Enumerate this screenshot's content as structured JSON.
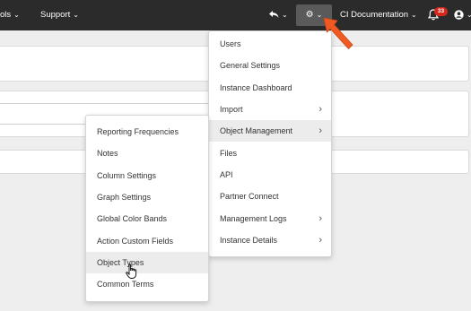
{
  "topbar": {
    "tools_label": "ols",
    "support_label": "Support",
    "ci_documentation_label": "CI Documentation",
    "notification_count": "33"
  },
  "settings_menu": {
    "items": [
      {
        "label": "Users",
        "has_submenu": false
      },
      {
        "label": "General Settings",
        "has_submenu": false
      },
      {
        "label": "Instance Dashboard",
        "has_submenu": false
      },
      {
        "label": "Import",
        "has_submenu": true
      },
      {
        "label": "Object Management",
        "has_submenu": true,
        "highlighted": true
      },
      {
        "label": "Files",
        "has_submenu": false
      },
      {
        "label": "API",
        "has_submenu": false
      },
      {
        "label": "Partner Connect",
        "has_submenu": false
      },
      {
        "label": "Management Logs",
        "has_submenu": true
      },
      {
        "label": "Instance Details",
        "has_submenu": true
      }
    ]
  },
  "object_management_submenu": {
    "items": [
      {
        "label": "Reporting Frequencies"
      },
      {
        "label": "Notes"
      },
      {
        "label": "Column Settings"
      },
      {
        "label": "Graph Settings"
      },
      {
        "label": "Global Color Bands"
      },
      {
        "label": "Action Custom Fields"
      },
      {
        "label": "Object Types",
        "highlighted": true
      },
      {
        "label": "Common Terms"
      }
    ]
  },
  "colors": {
    "topbar_bg": "#2b2b2b",
    "badge_bg": "#d9261c",
    "callout_arrow": "#f05a22",
    "menu_highlight": "#ececec"
  },
  "icons": [
    "undo-icon",
    "gear-icon",
    "bell-icon",
    "user-icon",
    "pointer-hand-icon",
    "callout-arrow"
  ]
}
